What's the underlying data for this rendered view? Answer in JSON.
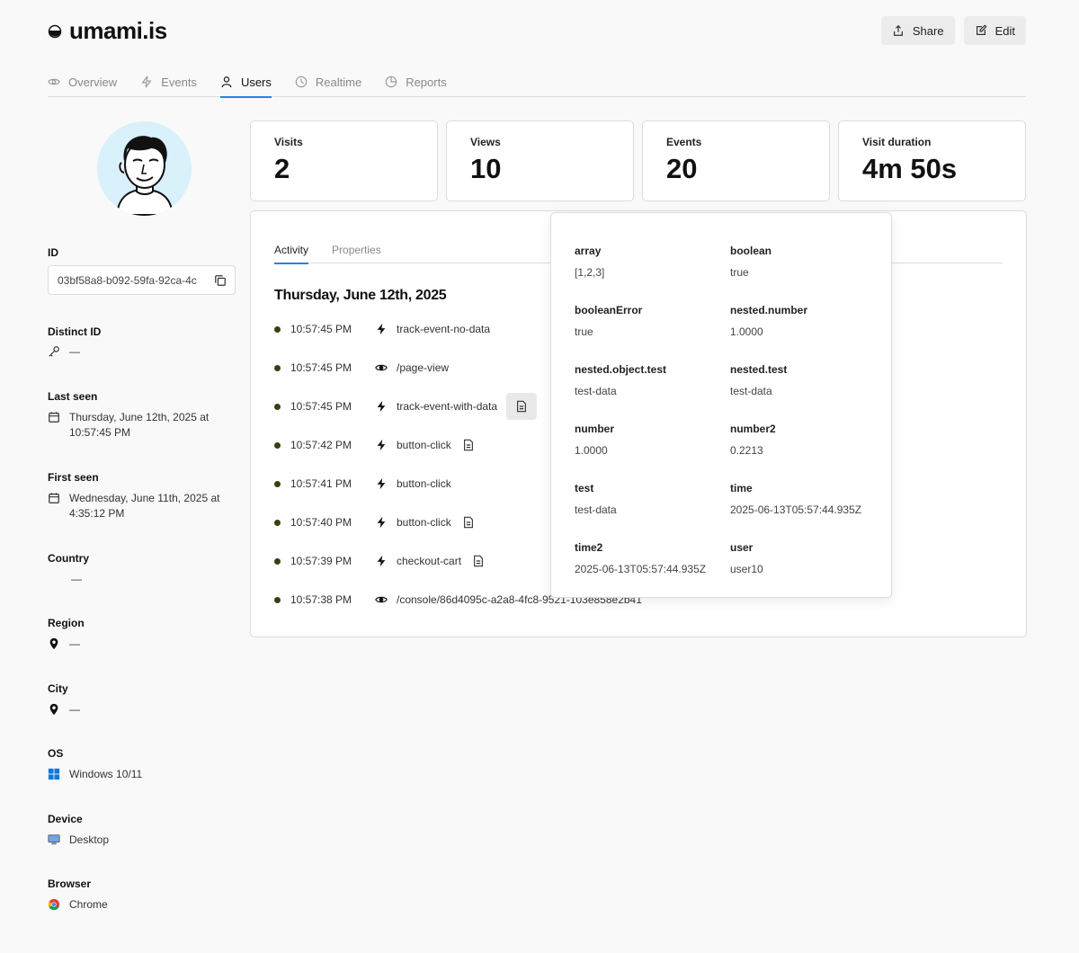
{
  "site": {
    "name": "umami.is"
  },
  "actions": {
    "share": "Share",
    "edit": "Edit"
  },
  "nav": [
    {
      "label": "Overview",
      "icon": "eye-icon"
    },
    {
      "label": "Events",
      "icon": "lightning-icon"
    },
    {
      "label": "Users",
      "icon": "user-icon",
      "active": true
    },
    {
      "label": "Realtime",
      "icon": "clock-icon"
    },
    {
      "label": "Reports",
      "icon": "pie-chart-icon"
    }
  ],
  "user": {
    "id_label": "ID",
    "id_value": "03bf58a8-b092-59fa-92ca-4c",
    "distinct_id_label": "Distinct ID",
    "distinct_id_value": "—",
    "last_seen_label": "Last seen",
    "last_seen_value": "Thursday, June 12th, 2025 at 10:57:45 PM",
    "first_seen_label": "First seen",
    "first_seen_value": "Wednesday, June 11th, 2025 at 4:35:12 PM",
    "country_label": "Country",
    "country_value": "—",
    "region_label": "Region",
    "region_value": "—",
    "city_label": "City",
    "city_value": "—",
    "os_label": "OS",
    "os_value": "Windows 10/11",
    "device_label": "Device",
    "device_value": "Desktop",
    "browser_label": "Browser",
    "browser_value": "Chrome"
  },
  "stats": [
    {
      "label": "Visits",
      "value": "2"
    },
    {
      "label": "Views",
      "value": "10"
    },
    {
      "label": "Events",
      "value": "20"
    },
    {
      "label": "Visit duration",
      "value": "4m 50s"
    }
  ],
  "tabs": {
    "activity": "Activity",
    "properties": "Properties"
  },
  "activity": {
    "date": "Thursday, June 12th, 2025",
    "rows": [
      {
        "time": "10:57:45 PM",
        "type": "event",
        "label": "track-event-no-data"
      },
      {
        "time": "10:57:45 PM",
        "type": "view",
        "label": "/page-view"
      },
      {
        "time": "10:57:45 PM",
        "type": "event",
        "label": "track-event-with-data",
        "has_data": true
      },
      {
        "time": "10:57:42 PM",
        "type": "event",
        "label": "button-click",
        "has_data": true
      },
      {
        "time": "10:57:41 PM",
        "type": "event",
        "label": "button-click"
      },
      {
        "time": "10:57:40 PM",
        "type": "event",
        "label": "button-click",
        "has_data": true
      },
      {
        "time": "10:57:39 PM",
        "type": "event",
        "label": "checkout-cart",
        "has_data": true
      },
      {
        "time": "10:57:38 PM",
        "type": "view",
        "label": "/console/86d4095c-a2a8-4fc8-9521-103e858e2b41"
      }
    ]
  },
  "event_data": [
    {
      "key": "array",
      "value": "[1,2,3]"
    },
    {
      "key": "boolean",
      "value": "true"
    },
    {
      "key": "booleanError",
      "value": "true"
    },
    {
      "key": "nested.number",
      "value": "1.0000"
    },
    {
      "key": "nested.object.test",
      "value": "test-data"
    },
    {
      "key": "nested.test",
      "value": "test-data"
    },
    {
      "key": "number",
      "value": "1.0000"
    },
    {
      "key": "number2",
      "value": "0.2213"
    },
    {
      "key": "test",
      "value": "test-data"
    },
    {
      "key": "time",
      "value": "2025-06-13T05:57:44.935Z"
    },
    {
      "key": "time2",
      "value": "2025-06-13T05:57:44.935Z"
    },
    {
      "key": "user",
      "value": "user10"
    }
  ],
  "colors": {
    "accent": "#2680eb",
    "bullet": "#3d3d10"
  }
}
